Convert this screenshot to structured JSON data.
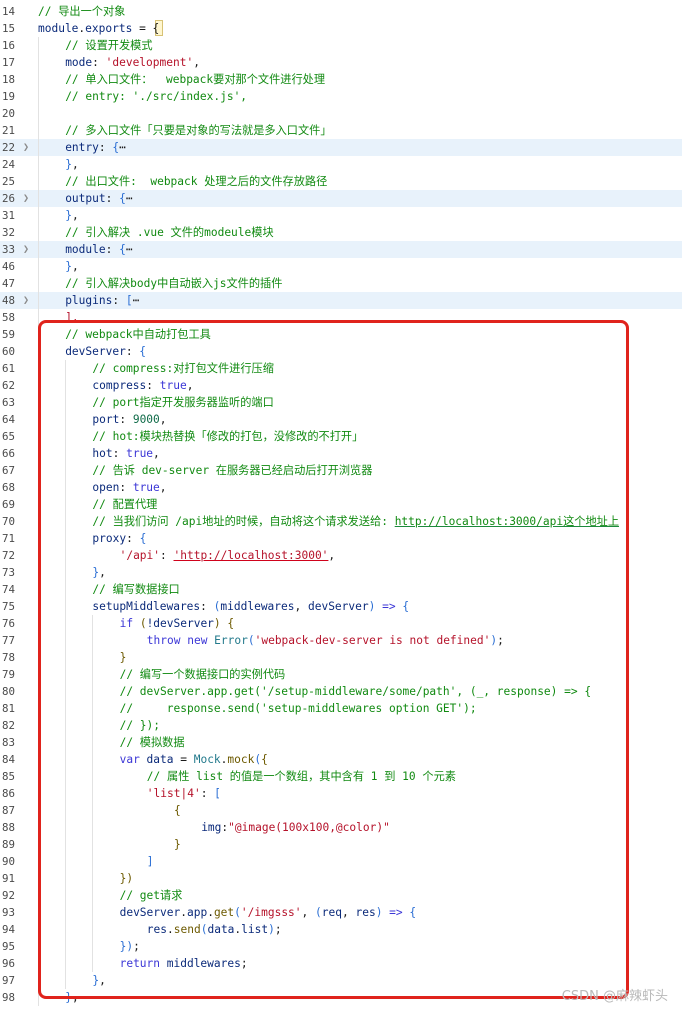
{
  "editor": {
    "lines": [
      {
        "n": "14",
        "fold": false,
        "hl": false,
        "indent": 0,
        "tokens": [
          {
            "t": "// 导出一个对象",
            "c": "c"
          }
        ]
      },
      {
        "n": "15",
        "fold": false,
        "hl": false,
        "indent": 0,
        "tokens": [
          {
            "t": "module",
            "c": "id"
          },
          {
            "t": ".",
            "c": "p"
          },
          {
            "t": "exports",
            "c": "id"
          },
          {
            "t": " = ",
            "c": "p"
          },
          {
            "t": "{",
            "c": "p"
          }
        ]
      },
      {
        "n": "16",
        "fold": false,
        "hl": false,
        "indent": 1,
        "tokens": [
          {
            "t": "// 设置开发模式",
            "c": "c"
          }
        ]
      },
      {
        "n": "17",
        "fold": false,
        "hl": false,
        "indent": 1,
        "tokens": [
          {
            "t": "mode",
            "c": "id"
          },
          {
            "t": ": ",
            "c": "p"
          },
          {
            "t": "'development'",
            "c": "s"
          },
          {
            "t": ",",
            "c": "p"
          }
        ]
      },
      {
        "n": "18",
        "fold": false,
        "hl": false,
        "indent": 1,
        "tokens": [
          {
            "t": "// 单入口文件：  webpack要对那个文件进行处理",
            "c": "c"
          }
        ]
      },
      {
        "n": "19",
        "fold": false,
        "hl": false,
        "indent": 1,
        "tokens": [
          {
            "t": "// entry: './src/index.js',",
            "c": "c"
          }
        ]
      },
      {
        "n": "20",
        "fold": false,
        "hl": false,
        "indent": 0,
        "tokens": []
      },
      {
        "n": "21",
        "fold": false,
        "hl": false,
        "indent": 1,
        "tokens": [
          {
            "t": "// 多入口文件「只要是对象的写法就是多入口文件」",
            "c": "c"
          }
        ]
      },
      {
        "n": "22",
        "fold": true,
        "hl": true,
        "indent": 1,
        "tokens": [
          {
            "t": "entry",
            "c": "id"
          },
          {
            "t": ": ",
            "c": "p"
          },
          {
            "t": "{",
            "c": "b"
          },
          {
            "t": "⋯",
            "c": "p"
          }
        ]
      },
      {
        "n": "24",
        "fold": false,
        "hl": false,
        "indent": 1,
        "tokens": [
          {
            "t": "}",
            "c": "b"
          },
          {
            "t": ",",
            "c": "p"
          }
        ]
      },
      {
        "n": "25",
        "fold": false,
        "hl": false,
        "indent": 1,
        "tokens": [
          {
            "t": "// 出口文件:  webpack 处理之后的文件存放路径",
            "c": "c"
          }
        ]
      },
      {
        "n": "26",
        "fold": true,
        "hl": true,
        "indent": 1,
        "tokens": [
          {
            "t": "output",
            "c": "id"
          },
          {
            "t": ": ",
            "c": "p"
          },
          {
            "t": "{",
            "c": "b"
          },
          {
            "t": "⋯",
            "c": "p"
          }
        ]
      },
      {
        "n": "31",
        "fold": false,
        "hl": false,
        "indent": 1,
        "tokens": [
          {
            "t": "}",
            "c": "b"
          },
          {
            "t": ",",
            "c": "p"
          }
        ]
      },
      {
        "n": "32",
        "fold": false,
        "hl": false,
        "indent": 1,
        "tokens": [
          {
            "t": "// 引入解决 .vue 文件的modeule模块",
            "c": "c"
          }
        ]
      },
      {
        "n": "33",
        "fold": true,
        "hl": true,
        "indent": 1,
        "tokens": [
          {
            "t": "module",
            "c": "id"
          },
          {
            "t": ": ",
            "c": "p"
          },
          {
            "t": "{",
            "c": "b"
          },
          {
            "t": "⋯",
            "c": "p"
          }
        ]
      },
      {
        "n": "46",
        "fold": false,
        "hl": false,
        "indent": 1,
        "tokens": [
          {
            "t": "}",
            "c": "b"
          },
          {
            "t": ",",
            "c": "p"
          }
        ]
      },
      {
        "n": "47",
        "fold": false,
        "hl": false,
        "indent": 1,
        "tokens": [
          {
            "t": "// 引入解决body中自动嵌入js文件的插件",
            "c": "c"
          }
        ]
      },
      {
        "n": "48",
        "fold": true,
        "hl": true,
        "indent": 1,
        "tokens": [
          {
            "t": "plugins",
            "c": "id"
          },
          {
            "t": ": ",
            "c": "p"
          },
          {
            "t": "[",
            "c": "b"
          },
          {
            "t": "⋯",
            "c": "p"
          }
        ]
      },
      {
        "n": "58",
        "fold": false,
        "hl": false,
        "indent": 1,
        "tokens": [
          {
            "t": "],",
            "c": "s"
          }
        ]
      },
      {
        "n": "59",
        "fold": false,
        "hl": false,
        "indent": 1,
        "tokens": [
          {
            "t": "// webpack中自动打包工具",
            "c": "c"
          }
        ]
      },
      {
        "n": "60",
        "fold": false,
        "hl": false,
        "indent": 1,
        "tokens": [
          {
            "t": "devServer",
            "c": "id"
          },
          {
            "t": ": ",
            "c": "p"
          },
          {
            "t": "{",
            "c": "b"
          }
        ]
      },
      {
        "n": "61",
        "fold": false,
        "hl": false,
        "indent": 2,
        "tokens": [
          {
            "t": "// compress:对打包文件进行压缩",
            "c": "c"
          }
        ]
      },
      {
        "n": "62",
        "fold": false,
        "hl": false,
        "indent": 2,
        "tokens": [
          {
            "t": "compress",
            "c": "id"
          },
          {
            "t": ": ",
            "c": "p"
          },
          {
            "t": "true",
            "c": "k"
          },
          {
            "t": ",",
            "c": "p"
          }
        ]
      },
      {
        "n": "63",
        "fold": false,
        "hl": false,
        "indent": 2,
        "tokens": [
          {
            "t": "// port指定开发服务器监听的端口",
            "c": "c"
          }
        ]
      },
      {
        "n": "64",
        "fold": false,
        "hl": false,
        "indent": 2,
        "tokens": [
          {
            "t": "port",
            "c": "id"
          },
          {
            "t": ": ",
            "c": "p"
          },
          {
            "t": "9000",
            "c": "n"
          },
          {
            "t": ",",
            "c": "p"
          }
        ]
      },
      {
        "n": "65",
        "fold": false,
        "hl": false,
        "indent": 2,
        "tokens": [
          {
            "t": "// hot:模块热替换「修改的打包，没修改的不打开」",
            "c": "c"
          }
        ]
      },
      {
        "n": "66",
        "fold": false,
        "hl": false,
        "indent": 2,
        "tokens": [
          {
            "t": "hot",
            "c": "id"
          },
          {
            "t": ": ",
            "c": "p"
          },
          {
            "t": "true",
            "c": "k"
          },
          {
            "t": ",",
            "c": "p"
          }
        ]
      },
      {
        "n": "67",
        "fold": false,
        "hl": false,
        "indent": 2,
        "tokens": [
          {
            "t": "// 告诉 dev-server 在服务器已经启动后打开浏览器",
            "c": "c"
          }
        ]
      },
      {
        "n": "68",
        "fold": false,
        "hl": false,
        "indent": 2,
        "tokens": [
          {
            "t": "open",
            "c": "id"
          },
          {
            "t": ": ",
            "c": "p"
          },
          {
            "t": "true",
            "c": "k"
          },
          {
            "t": ",",
            "c": "p"
          }
        ]
      },
      {
        "n": "69",
        "fold": false,
        "hl": false,
        "indent": 2,
        "tokens": [
          {
            "t": "// 配置代理",
            "c": "c"
          }
        ]
      },
      {
        "n": "70",
        "fold": false,
        "hl": false,
        "indent": 2,
        "tokens": [
          {
            "t": "// 当我们访问 /api地址的时候，自动将这个请求发送给: ",
            "c": "c"
          },
          {
            "t": "http://localhost:3000/api这个地址上",
            "c": "c",
            "u": "green"
          }
        ]
      },
      {
        "n": "71",
        "fold": false,
        "hl": false,
        "indent": 2,
        "tokens": [
          {
            "t": "proxy",
            "c": "id"
          },
          {
            "t": ": ",
            "c": "p"
          },
          {
            "t": "{",
            "c": "b"
          }
        ]
      },
      {
        "n": "72",
        "fold": false,
        "hl": false,
        "indent": 3,
        "tokens": [
          {
            "t": "'/api'",
            "c": "s"
          },
          {
            "t": ": ",
            "c": "p"
          },
          {
            "t": "'http://localhost:3000'",
            "c": "s",
            "u": "red"
          },
          {
            "t": ",",
            "c": "p"
          }
        ]
      },
      {
        "n": "73",
        "fold": false,
        "hl": false,
        "indent": 2,
        "tokens": [
          {
            "t": "}",
            "c": "b"
          },
          {
            "t": ",",
            "c": "p"
          }
        ]
      },
      {
        "n": "74",
        "fold": false,
        "hl": false,
        "indent": 2,
        "tokens": [
          {
            "t": "// 编写数据接口",
            "c": "c"
          }
        ]
      },
      {
        "n": "75",
        "fold": false,
        "hl": false,
        "indent": 2,
        "tokens": [
          {
            "t": "setupMiddlewares",
            "c": "id"
          },
          {
            "t": ": ",
            "c": "p"
          },
          {
            "t": "(",
            "c": "b"
          },
          {
            "t": "middlewares",
            "c": "id"
          },
          {
            "t": ", ",
            "c": "p"
          },
          {
            "t": "devServer",
            "c": "id"
          },
          {
            "t": ")",
            "c": "b"
          },
          {
            "t": " => ",
            "c": "k"
          },
          {
            "t": "{",
            "c": "b"
          }
        ]
      },
      {
        "n": "76",
        "fold": false,
        "hl": false,
        "indent": 3,
        "tokens": [
          {
            "t": "if",
            "c": "k"
          },
          {
            "t": " (",
            "c": "f"
          },
          {
            "t": "!devServer",
            "c": "id"
          },
          {
            "t": ")",
            "c": "f"
          },
          {
            "t": " {",
            "c": "f"
          }
        ]
      },
      {
        "n": "77",
        "fold": false,
        "hl": false,
        "indent": 4,
        "tokens": [
          {
            "t": "throw",
            "c": "k"
          },
          {
            "t": " new ",
            "c": "k"
          },
          {
            "t": "Error",
            "c": "t"
          },
          {
            "t": "(",
            "c": "b"
          },
          {
            "t": "'webpack-dev-server is not defined'",
            "c": "s"
          },
          {
            "t": ")",
            "c": "b"
          },
          {
            "t": ";",
            "c": "p"
          }
        ]
      },
      {
        "n": "78",
        "fold": false,
        "hl": false,
        "indent": 3,
        "tokens": [
          {
            "t": "}",
            "c": "f"
          }
        ]
      },
      {
        "n": "79",
        "fold": false,
        "hl": false,
        "indent": 3,
        "tokens": [
          {
            "t": "// 编写一个数据接口的实例代码",
            "c": "c"
          }
        ]
      },
      {
        "n": "80",
        "fold": false,
        "hl": false,
        "indent": 3,
        "tokens": [
          {
            "t": "// devServer.app.get('/setup-middleware/some/path', (_, response) => {",
            "c": "c"
          }
        ]
      },
      {
        "n": "81",
        "fold": false,
        "hl": false,
        "indent": 3,
        "tokens": [
          {
            "t": "//     response.send('setup-middlewares option GET');",
            "c": "c"
          }
        ]
      },
      {
        "n": "82",
        "fold": false,
        "hl": false,
        "indent": 3,
        "tokens": [
          {
            "t": "// });",
            "c": "c"
          }
        ]
      },
      {
        "n": "83",
        "fold": false,
        "hl": false,
        "indent": 3,
        "tokens": [
          {
            "t": "// 模拟数据",
            "c": "c"
          }
        ]
      },
      {
        "n": "84",
        "fold": false,
        "hl": false,
        "indent": 3,
        "tokens": [
          {
            "t": "var",
            "c": "k"
          },
          {
            "t": " data",
            "c": "id"
          },
          {
            "t": " = ",
            "c": "p"
          },
          {
            "t": "Mock",
            "c": "t"
          },
          {
            "t": ".",
            "c": "p"
          },
          {
            "t": "mock",
            "c": "f"
          },
          {
            "t": "(",
            "c": "b"
          },
          {
            "t": "{",
            "c": "f"
          }
        ]
      },
      {
        "n": "85",
        "fold": false,
        "hl": false,
        "indent": 4,
        "tokens": [
          {
            "t": "// 属性 list 的值是一个数组，其中含有 1 到 10 个元素",
            "c": "c"
          }
        ]
      },
      {
        "n": "86",
        "fold": false,
        "hl": false,
        "indent": 4,
        "tokens": [
          {
            "t": "'list|4'",
            "c": "s"
          },
          {
            "t": ": ",
            "c": "p"
          },
          {
            "t": "[",
            "c": "b"
          }
        ]
      },
      {
        "n": "87",
        "fold": false,
        "hl": false,
        "indent": 5,
        "tokens": [
          {
            "t": "{",
            "c": "f"
          }
        ]
      },
      {
        "n": "88",
        "fold": false,
        "hl": false,
        "indent": 6,
        "tokens": [
          {
            "t": "img",
            "c": "id"
          },
          {
            "t": ":",
            "c": "p"
          },
          {
            "t": "\"@image(100x100,@color)\"",
            "c": "s"
          }
        ]
      },
      {
        "n": "89",
        "fold": false,
        "hl": false,
        "indent": 5,
        "tokens": [
          {
            "t": "}",
            "c": "f"
          }
        ]
      },
      {
        "n": "90",
        "fold": false,
        "hl": false,
        "indent": 4,
        "tokens": [
          {
            "t": "]",
            "c": "b"
          }
        ]
      },
      {
        "n": "91",
        "fold": false,
        "hl": false,
        "indent": 3,
        "tokens": [
          {
            "t": "})",
            "c": "f"
          }
        ]
      },
      {
        "n": "92",
        "fold": false,
        "hl": false,
        "indent": 3,
        "tokens": [
          {
            "t": "// get请求",
            "c": "c"
          }
        ]
      },
      {
        "n": "93",
        "fold": false,
        "hl": false,
        "indent": 3,
        "tokens": [
          {
            "t": "devServer",
            "c": "id"
          },
          {
            "t": ".",
            "c": "p"
          },
          {
            "t": "app",
            "c": "id"
          },
          {
            "t": ".",
            "c": "p"
          },
          {
            "t": "get",
            "c": "f"
          },
          {
            "t": "(",
            "c": "b"
          },
          {
            "t": "'/imgsss'",
            "c": "s"
          },
          {
            "t": ", ",
            "c": "p"
          },
          {
            "t": "(",
            "c": "b"
          },
          {
            "t": "req",
            "c": "id"
          },
          {
            "t": ", ",
            "c": "p"
          },
          {
            "t": "res",
            "c": "id"
          },
          {
            "t": ")",
            "c": "b"
          },
          {
            "t": " => ",
            "c": "k"
          },
          {
            "t": "{",
            "c": "b"
          }
        ]
      },
      {
        "n": "94",
        "fold": false,
        "hl": false,
        "indent": 4,
        "tokens": [
          {
            "t": "res",
            "c": "id"
          },
          {
            "t": ".",
            "c": "p"
          },
          {
            "t": "send",
            "c": "f"
          },
          {
            "t": "(",
            "c": "b"
          },
          {
            "t": "data",
            "c": "id"
          },
          {
            "t": ".",
            "c": "p"
          },
          {
            "t": "list",
            "c": "id"
          },
          {
            "t": ")",
            "c": "b"
          },
          {
            "t": ";",
            "c": "p"
          }
        ]
      },
      {
        "n": "95",
        "fold": false,
        "hl": false,
        "indent": 3,
        "tokens": [
          {
            "t": "})",
            "c": "b"
          },
          {
            "t": ";",
            "c": "p"
          }
        ]
      },
      {
        "n": "96",
        "fold": false,
        "hl": false,
        "indent": 3,
        "tokens": [
          {
            "t": "return",
            "c": "k"
          },
          {
            "t": " middlewares",
            "c": "id"
          },
          {
            "t": ";",
            "c": "p"
          }
        ]
      },
      {
        "n": "97",
        "fold": false,
        "hl": false,
        "indent": 2,
        "tokens": [
          {
            "t": "}",
            "c": "b"
          },
          {
            "t": ",",
            "c": "p"
          }
        ]
      },
      {
        "n": "98",
        "fold": false,
        "hl": false,
        "indent": 1,
        "tokens": [
          {
            "t": "}",
            "c": "b"
          },
          {
            "t": ",",
            "c": "p"
          }
        ]
      }
    ]
  },
  "annotation": {
    "box_color": "#e0231c"
  },
  "watermark": {
    "text": "CSDN @麻辣虾头"
  },
  "colors": {
    "comment": "#118a11",
    "string": "#b5122a",
    "keyword": "#3b36d6",
    "number": "#0f6b48",
    "fold_highlight": "#e8f2fb"
  }
}
